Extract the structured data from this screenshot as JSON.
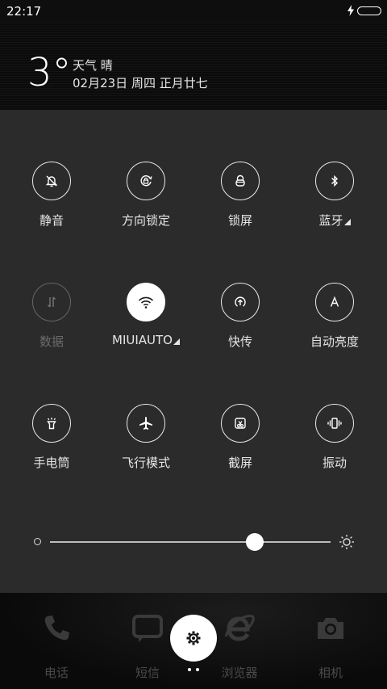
{
  "status_bar": {
    "time": "22:17",
    "charging_icon": "bolt-icon",
    "battery_icon": "battery-icon"
  },
  "weather": {
    "temperature": "3°",
    "label": "天气  晴",
    "date": "02月23日 周四 正月廿七"
  },
  "toggles": [
    {
      "label": "静音",
      "icon": "silent-bell-icon",
      "state": "off"
    },
    {
      "label": "方向锁定",
      "icon": "rotation-lock-icon",
      "state": "off"
    },
    {
      "label": "锁屏",
      "icon": "lock-icon",
      "state": "off"
    },
    {
      "label": "蓝牙",
      "icon": "bluetooth-icon",
      "state": "off",
      "expandable": true
    },
    {
      "label": "数据",
      "icon": "mobile-data-icon",
      "state": "disabled"
    },
    {
      "label": "MIUIAUTO",
      "icon": "wifi-icon",
      "state": "on",
      "expandable": true
    },
    {
      "label": "快传",
      "icon": "quick-transfer-icon",
      "state": "off"
    },
    {
      "label": "自动亮度",
      "icon": "auto-brightness-icon",
      "state": "off"
    },
    {
      "label": "手电筒",
      "icon": "flashlight-icon",
      "state": "off"
    },
    {
      "label": "飞行模式",
      "icon": "airplane-icon",
      "state": "off"
    },
    {
      "label": "截屏",
      "icon": "screenshot-icon",
      "state": "off"
    },
    {
      "label": "振动",
      "icon": "vibrate-icon",
      "state": "off"
    }
  ],
  "brightness": {
    "level": 0.73
  },
  "dock": [
    {
      "label": "电话",
      "icon": "phone-icon"
    },
    {
      "label": "短信",
      "icon": "message-icon"
    },
    {
      "label": "浏览器",
      "icon": "browser-icon"
    },
    {
      "label": "相机",
      "icon": "camera-icon"
    }
  ],
  "colors": {
    "panel": "#2b2b2b",
    "accent": "#ffffff",
    "dock_label": "#4a4a4a"
  }
}
